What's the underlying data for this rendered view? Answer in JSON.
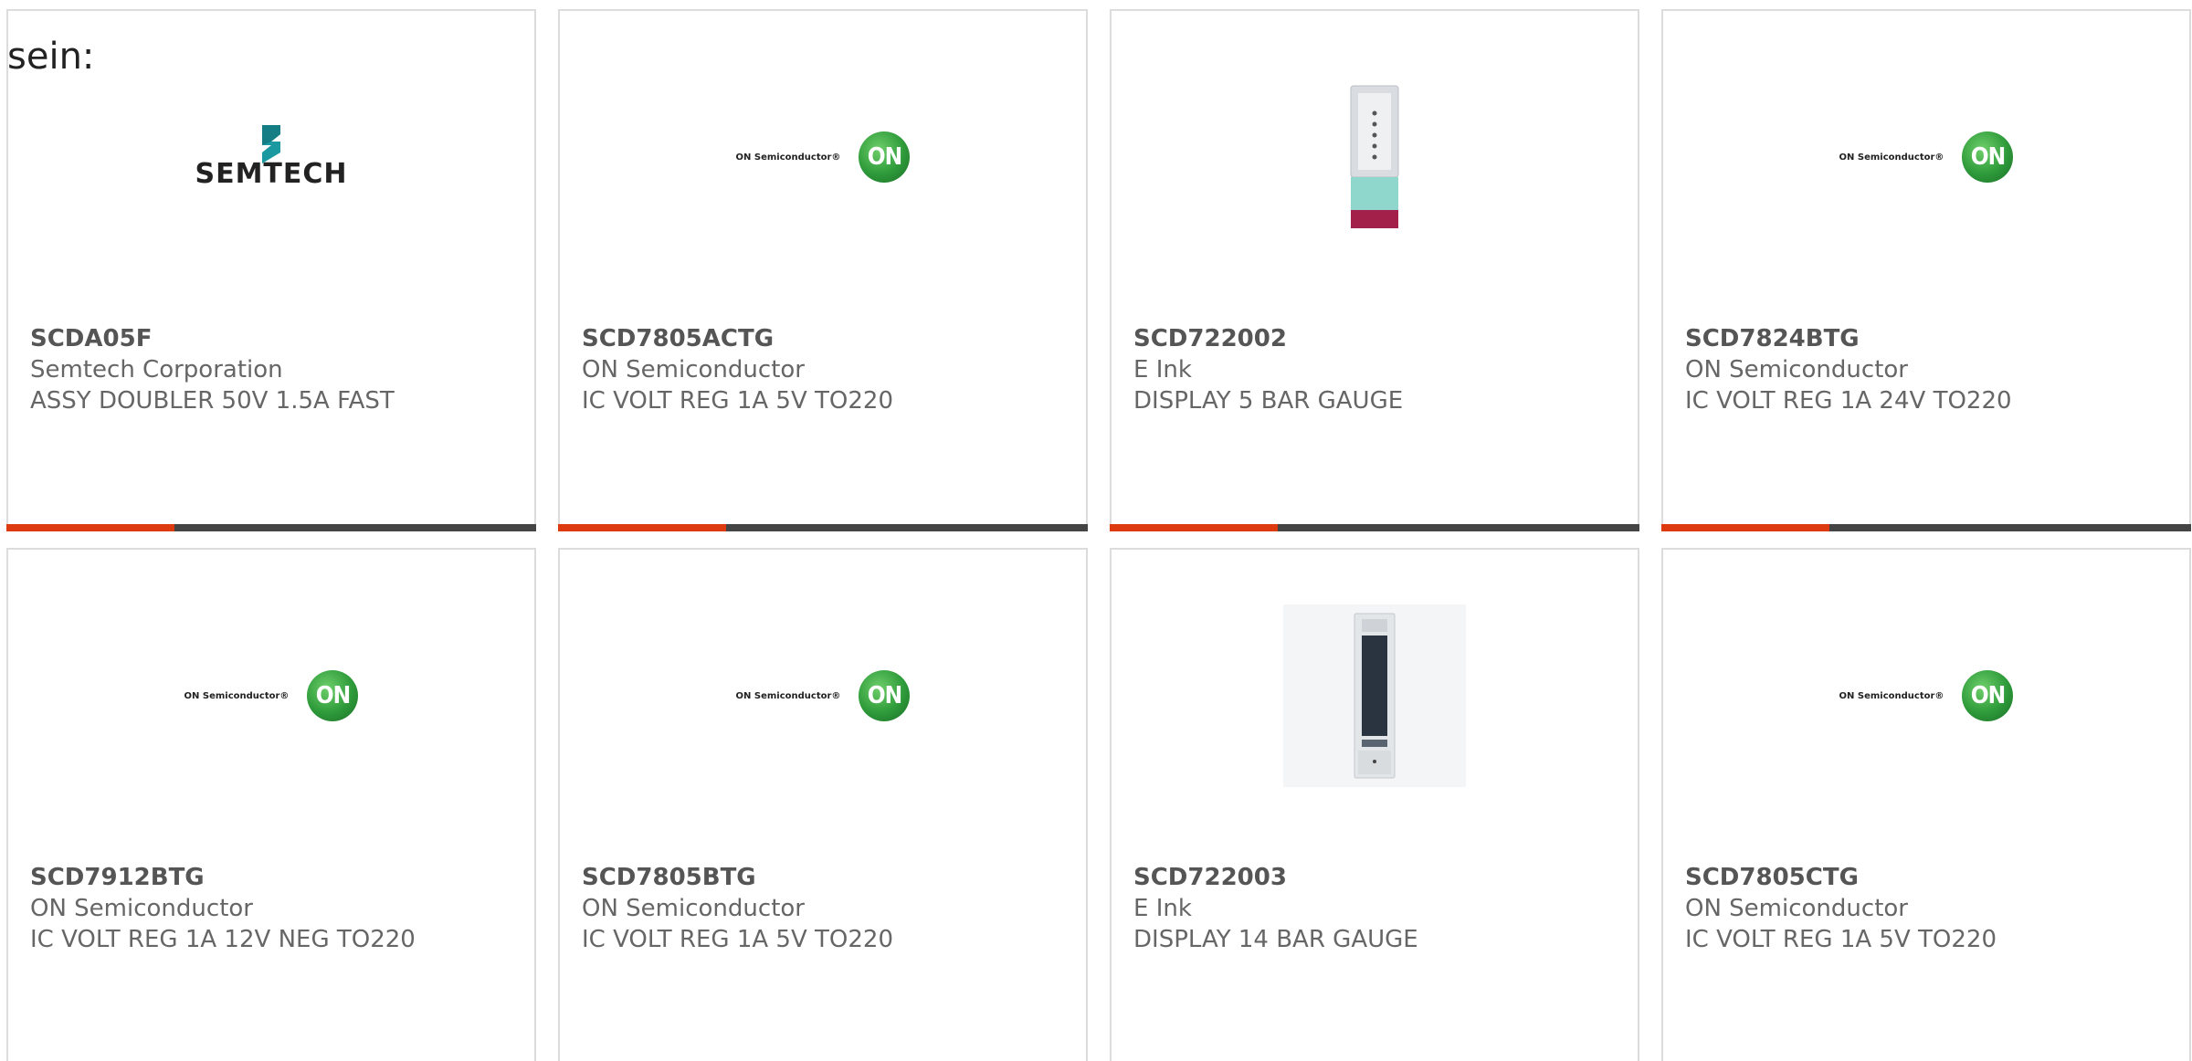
{
  "page": {
    "lead_text": "sein:"
  },
  "colors": {
    "accent": "#dd3a10",
    "bar_track": "#444444",
    "border": "#dcdcdc"
  },
  "products": [
    {
      "part": "SCDA05F",
      "manufacturer": "Semtech Corporation",
      "description": "ASSY DOUBLER 50V 1.5A FAST",
      "image": "semtech-logo",
      "logo_text": "SEMTECH"
    },
    {
      "part": "SCD7805ACTG",
      "manufacturer": "ON Semiconductor",
      "description": "IC VOLT REG 1A 5V TO220",
      "image": "on-semiconductor-logo",
      "logo_text": "ON Semiconductor®",
      "badge": "ON"
    },
    {
      "part": "SCD722002",
      "manufacturer": "E Ink",
      "description": "DISPLAY 5 BAR GAUGE",
      "image": "e-ink-display-5-bar"
    },
    {
      "part": "SCD7824BTG",
      "manufacturer": "ON Semiconductor",
      "description": "IC VOLT REG 1A 24V TO220",
      "image": "on-semiconductor-logo",
      "logo_text": "ON Semiconductor®",
      "badge": "ON"
    },
    {
      "part": "SCD7912BTG",
      "manufacturer": "ON Semiconductor",
      "description": "IC VOLT REG 1A 12V NEG TO220",
      "image": "on-semiconductor-logo",
      "logo_text": "ON Semiconductor®",
      "badge": "ON"
    },
    {
      "part": "SCD7805BTG",
      "manufacturer": "ON Semiconductor",
      "description": "IC VOLT REG 1A 5V TO220",
      "image": "on-semiconductor-logo",
      "logo_text": "ON Semiconductor®",
      "badge": "ON"
    },
    {
      "part": "SCD722003",
      "manufacturer": "E Ink",
      "description": "DISPLAY 14 BAR GAUGE",
      "image": "e-ink-display-14-bar"
    },
    {
      "part": "SCD7805CTG",
      "manufacturer": "ON Semiconductor",
      "description": "IC VOLT REG 1A 5V TO220",
      "image": "on-semiconductor-logo",
      "logo_text": "ON Semiconductor®",
      "badge": "ON"
    }
  ]
}
